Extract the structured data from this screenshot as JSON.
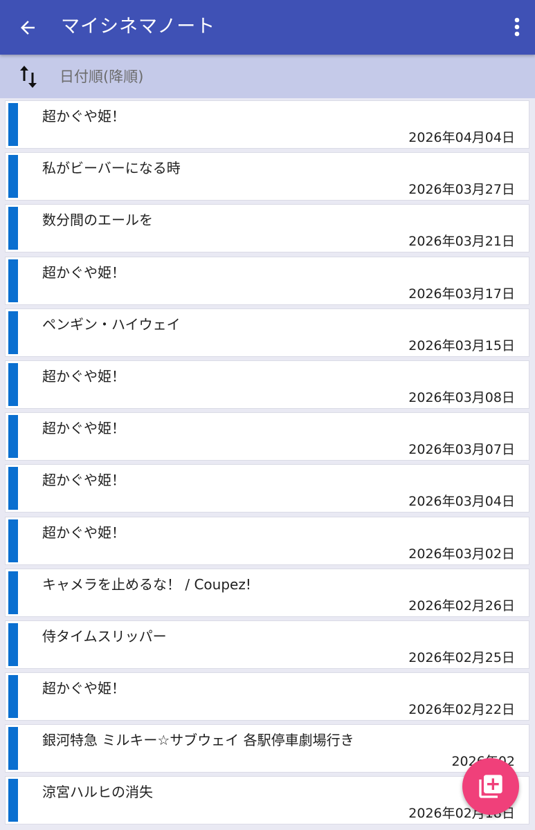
{
  "app_bar": {
    "title": "マイシネマノート",
    "back_icon": "arrow-left-icon",
    "menu_icon": "more-vert-icon",
    "color": "#3f51b5"
  },
  "sort_bar": {
    "label": "日付順(降順)",
    "icon": "sort-arrows-icon",
    "color": "#c5cae9"
  },
  "entries": [
    {
      "title": "超かぐや姫！",
      "date": "2026年04月04日"
    },
    {
      "title": "私がビーバーになる時",
      "date": "2026年03月27日"
    },
    {
      "title": "数分間のエールを",
      "date": "2026年03月21日"
    },
    {
      "title": "超かぐや姫！",
      "date": "2026年03月17日"
    },
    {
      "title": "ペンギン・ハイウェイ",
      "date": "2026年03月15日"
    },
    {
      "title": "超かぐや姫！",
      "date": "2026年03月08日"
    },
    {
      "title": "超かぐや姫！",
      "date": "2026年03月07日"
    },
    {
      "title": "超かぐや姫！",
      "date": "2026年03月04日"
    },
    {
      "title": "超かぐや姫！",
      "date": "2026年03月02日"
    },
    {
      "title": "キャメラを止めるな！ / Coupez!",
      "date": "2026年02月26日"
    },
    {
      "title": "侍タイムスリッパー",
      "date": "2026年02月25日"
    },
    {
      "title": "超かぐや姫！",
      "date": "2026年02月22日"
    },
    {
      "title": "銀河特急 ミルキー☆サブウェイ 各駅停車劇場行き",
      "date": "2026年02"
    },
    {
      "title": "涼宮ハルヒの消失",
      "date": "2026年02月18日"
    }
  ],
  "entry_accent_color": "#0a6fd0",
  "fab": {
    "icon": "add-to-library-icon",
    "color": "#f0407a"
  }
}
